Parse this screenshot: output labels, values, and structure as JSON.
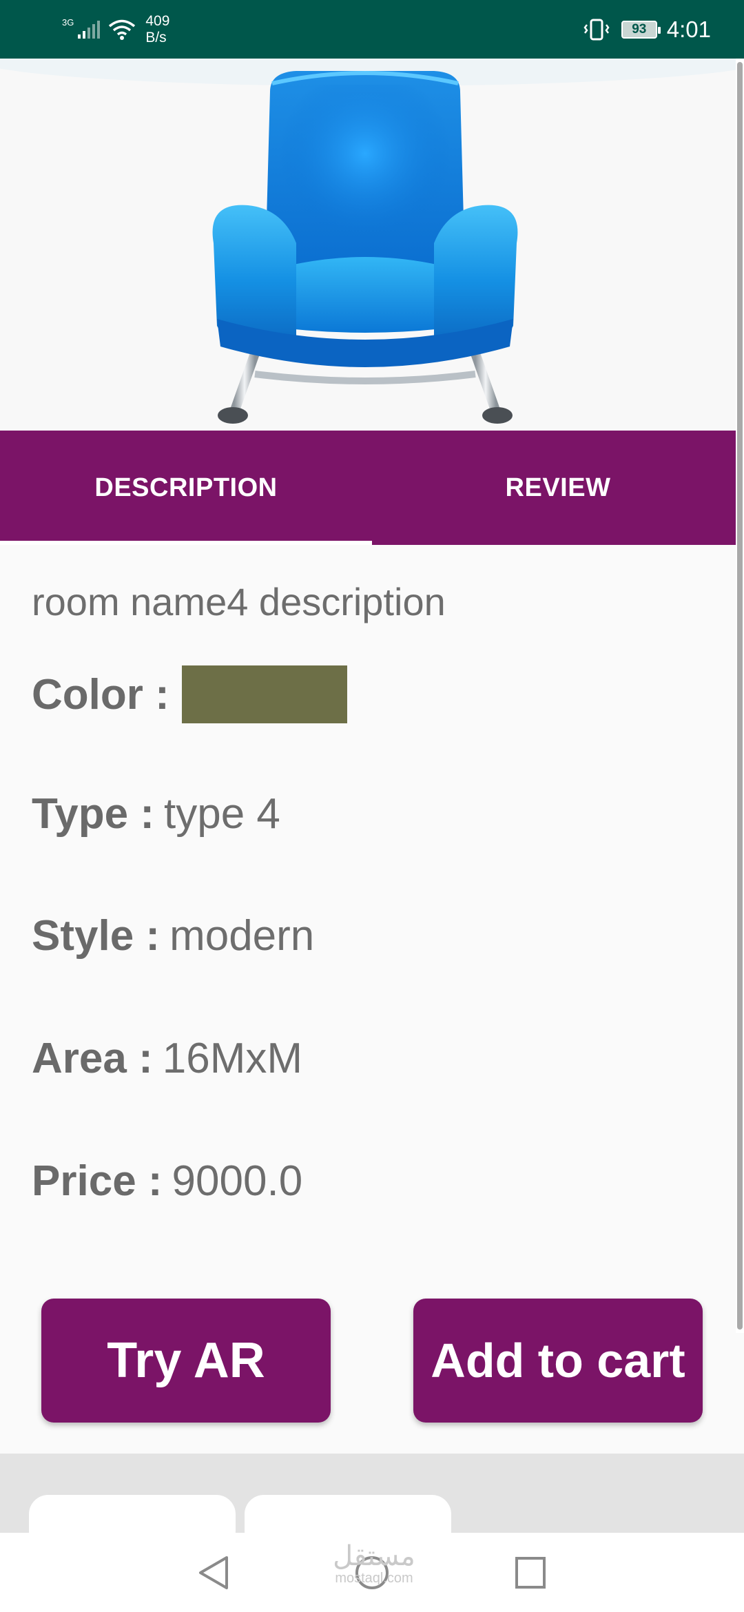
{
  "status_bar": {
    "network": "3G",
    "speed_value": "409",
    "speed_unit": "B/s",
    "battery": "93",
    "time": "4:01"
  },
  "product": {
    "image_icon": "armchair-image"
  },
  "tabs": [
    {
      "label": "DESCRIPTION",
      "selected": true
    },
    {
      "label": "REVIEW",
      "selected": false
    }
  ],
  "details": {
    "description": "room name4 description",
    "color_label": "Color :",
    "color_value": "#6d6f47",
    "type_label": "Type :",
    "type_value": "type 4",
    "style_label": "Style :",
    "style_value": "modern",
    "area_label": "Area :",
    "area_value": "16MxM",
    "price_label": "Price :",
    "price_value": "9000.0"
  },
  "buttons": {
    "try_ar": "Try AR",
    "add_to_cart": "Add to cart"
  },
  "watermark": {
    "arabic": "مستقل",
    "latin": "mostaql.com"
  },
  "colors": {
    "status_bar": "#00574b",
    "accent": "#7b1467"
  }
}
